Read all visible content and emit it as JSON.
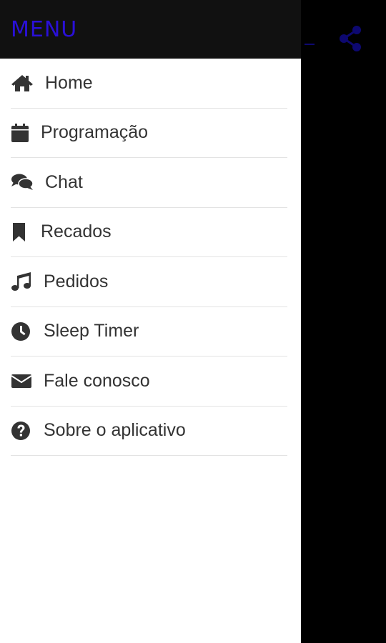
{
  "drawer": {
    "title": "MENU"
  },
  "menu": [
    {
      "label": "Home",
      "icon": "home-icon"
    },
    {
      "label": "Programação",
      "icon": "calendar-icon"
    },
    {
      "label": "Chat",
      "icon": "chat-icon"
    },
    {
      "label": "Recados",
      "icon": "bookmark-icon"
    },
    {
      "label": "Pedidos",
      "icon": "music-note-icon"
    },
    {
      "label": "Sleep Timer",
      "icon": "clock-icon"
    },
    {
      "label": "Fale conosco",
      "icon": "envelope-icon"
    },
    {
      "label": "Sobre o aplicativo",
      "icon": "question-circle-icon"
    }
  ],
  "toolbar": {
    "share_icon": "share-icon"
  },
  "colors": {
    "accent": "#2a10d8",
    "header_bg": "#111111",
    "drawer_bg": "#ffffff",
    "icon": "#333333"
  }
}
